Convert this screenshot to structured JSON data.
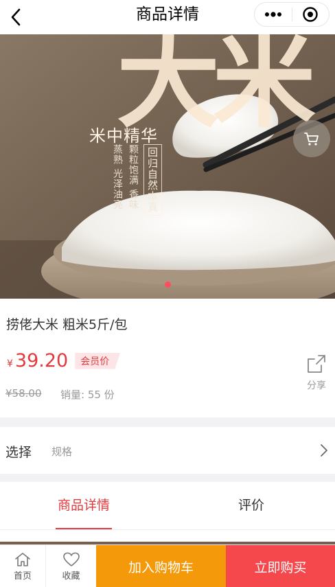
{
  "navbar": {
    "title": "商品详情",
    "back_icon": "back-arrow-icon",
    "more_icon": "more-dots-icon",
    "close_icon": "target-circle-icon"
  },
  "hero": {
    "big_text": "大米",
    "tagline": "米中精华",
    "vertical_text_1": "蒸熟 光泽油亮",
    "vertical_text_2": "颗粒饱满 香味",
    "stamp_text": "回归自然本真",
    "cart_icon": "cart-icon",
    "slide_count": 1,
    "active_slide": 1
  },
  "product": {
    "name": "捞佬大米 粗米5斤/包",
    "price_symbol": "¥",
    "price": "39.20",
    "member_tag": "会员价",
    "original_price": "¥58.00",
    "sales_text": "销量: 55 份",
    "share_label": "分享",
    "share_icon": "share-icon"
  },
  "select": {
    "label": "选择",
    "value": "规格",
    "arrow_icon": "chevron-right-icon"
  },
  "tabs": [
    {
      "label": "商品详情",
      "active": true
    },
    {
      "label": "评价",
      "active": false
    }
  ],
  "bottom_bar": {
    "home_label": "首页",
    "home_icon": "home-icon",
    "favorite_label": "收藏",
    "favorite_icon": "heart-icon",
    "add_cart_label": "加入购物车",
    "buy_now_label": "立即购买"
  },
  "colors": {
    "accent_red": "#e4393c",
    "cart_orange": "#f4990a",
    "buy_red": "#f5484d",
    "member_tag_bg": "#fde5e7"
  }
}
